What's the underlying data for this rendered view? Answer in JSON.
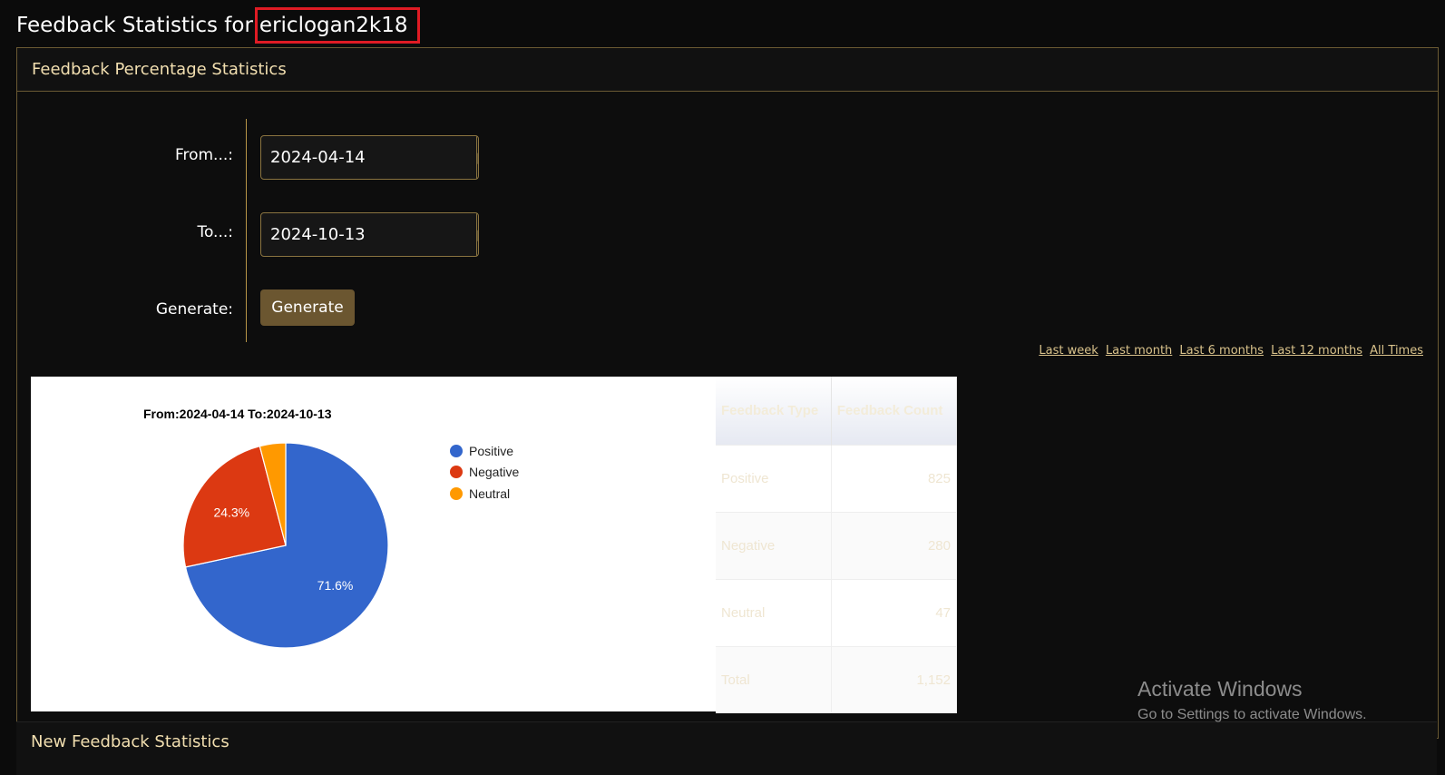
{
  "page": {
    "title_prefix": "Feedback Statistics for",
    "username": "ericlogan2k18"
  },
  "panel": {
    "header": "Feedback Percentage Statistics",
    "form": {
      "from_label": "From...:",
      "from_value": "2024-04-14",
      "to_label": "To...:",
      "to_value": "2024-10-13",
      "generate_label": "Generate:",
      "generate_button": "Generate"
    },
    "quick_links": [
      "Last week",
      "Last month",
      "Last 6 months",
      "Last 12 months",
      "All Times"
    ]
  },
  "chart_data": {
    "type": "pie",
    "title": "From:2024-04-14 To:2024-10-13",
    "categories": [
      "Positive",
      "Negative",
      "Neutral"
    ],
    "values": [
      825,
      280,
      47
    ],
    "percent_labels": [
      "71.6%",
      "24.3%",
      ""
    ],
    "colors": [
      "#3366cc",
      "#dc3912",
      "#ff9900"
    ],
    "legend_position": "right"
  },
  "table": {
    "headers": [
      "Feedback Type",
      "Feedback Count"
    ],
    "rows": [
      [
        "Positive",
        "825"
      ],
      [
        "Negative",
        "280"
      ],
      [
        "Neutral",
        "47"
      ],
      [
        "Total",
        "1,152"
      ]
    ]
  },
  "panel2": {
    "header": "New Feedback Statistics"
  },
  "watermark": {
    "line1": "Activate Windows",
    "line2": "Go to Settings to activate Windows."
  }
}
